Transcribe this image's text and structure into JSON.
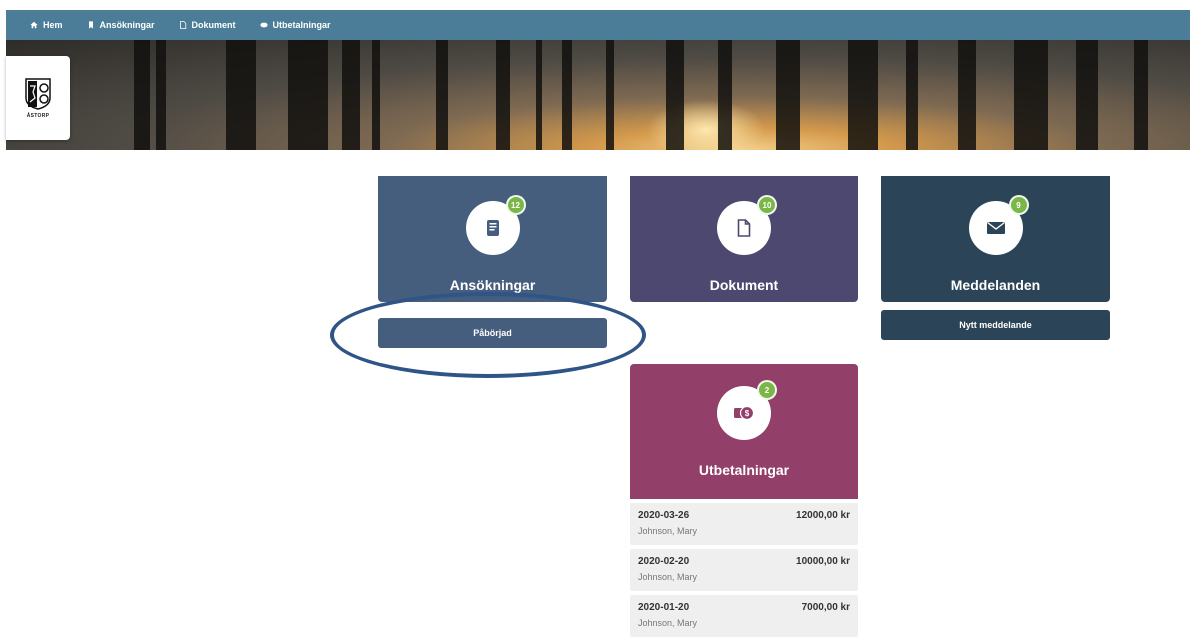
{
  "nav": {
    "items": [
      {
        "label": "Hem",
        "icon": "home-icon"
      },
      {
        "label": "Ansökningar",
        "icon": "bookmark-icon"
      },
      {
        "label": "Dokument",
        "icon": "document-icon"
      },
      {
        "label": "Utbetalningar",
        "icon": "money-icon"
      }
    ]
  },
  "logo": {
    "text": "ÅSTORP"
  },
  "cards": {
    "ansokningar": {
      "title": "Ansökningar",
      "badge": "12",
      "icon": "form-icon",
      "color": "#455e7e"
    },
    "dokument": {
      "title": "Dokument",
      "badge": "10",
      "icon": "document-icon",
      "color": "#4d4870"
    },
    "meddelanden": {
      "title": "Meddelanden",
      "badge": "9",
      "icon": "envelope-icon",
      "color": "#2b4457"
    },
    "utbetalningar": {
      "title": "Utbetalningar",
      "badge": "2",
      "icon": "money-icon",
      "color": "#923f6a"
    }
  },
  "buttons": {
    "paborjad": "Påbörjad",
    "nytt_meddelande": "Nytt meddelande"
  },
  "payments": [
    {
      "date": "2020-03-26",
      "amount": "12000,00 kr",
      "name": "Johnson, Mary"
    },
    {
      "date": "2020-02-20",
      "amount": "10000,00 kr",
      "name": "Johnson, Mary"
    },
    {
      "date": "2020-01-20",
      "amount": "7000,00 kr",
      "name": "Johnson, Mary"
    }
  ],
  "colors": {
    "nav": "#4b7d98",
    "badge": "#7ab648",
    "annotation": "#2f5486"
  }
}
